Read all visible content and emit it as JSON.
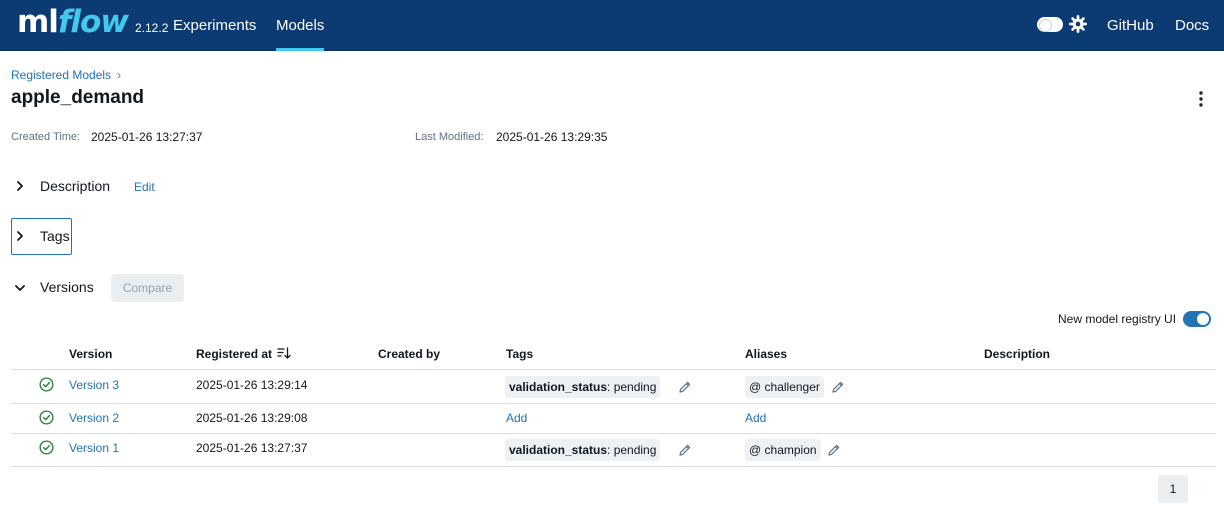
{
  "header": {
    "logo_ml": "ml",
    "logo_flow": "flow",
    "version": "2.12.2",
    "nav": {
      "experiments": "Experiments",
      "models": "Models",
      "github": "GitHub",
      "docs": "Docs"
    },
    "colors": {
      "bar": "#0c3a73",
      "accent": "#43c9ed"
    }
  },
  "breadcrumb": {
    "parent": "Registered Models",
    "separator": "›"
  },
  "page": {
    "title": "apple_demand",
    "created_label": "Created Time:",
    "created_value": "2025-01-26 13:27:37",
    "modified_label": "Last Modified:",
    "modified_value": "2025-01-26 13:29:35"
  },
  "sections": {
    "description": "Description",
    "edit": "Edit",
    "tags": "Tags",
    "versions": "Versions",
    "compare": "Compare"
  },
  "toggle": {
    "label": "New model registry UI",
    "enabled": true
  },
  "table": {
    "columns": {
      "version": "Version",
      "registered_at": "Registered at",
      "created_by": "Created by",
      "tags": "Tags",
      "aliases": "Aliases",
      "description": "Description"
    },
    "rows": [
      {
        "version": "Version 3",
        "registered": "2025-01-26 13:29:14",
        "tag_key": "validation_status",
        "tag_value": ": pending",
        "alias": "@ challenger",
        "add_tag": "",
        "add_alias": ""
      },
      {
        "version": "Version 2",
        "registered": "2025-01-26 13:29:08",
        "tag_key": "",
        "tag_value": "",
        "alias": "",
        "add_tag": "Add",
        "add_alias": "Add"
      },
      {
        "version": "Version 1",
        "registered": "2025-01-26 13:27:37",
        "tag_key": "validation_status",
        "tag_value": ": pending",
        "alias": "@ champion",
        "add_tag": "",
        "add_alias": ""
      }
    ]
  },
  "pagination": {
    "current": "1"
  }
}
